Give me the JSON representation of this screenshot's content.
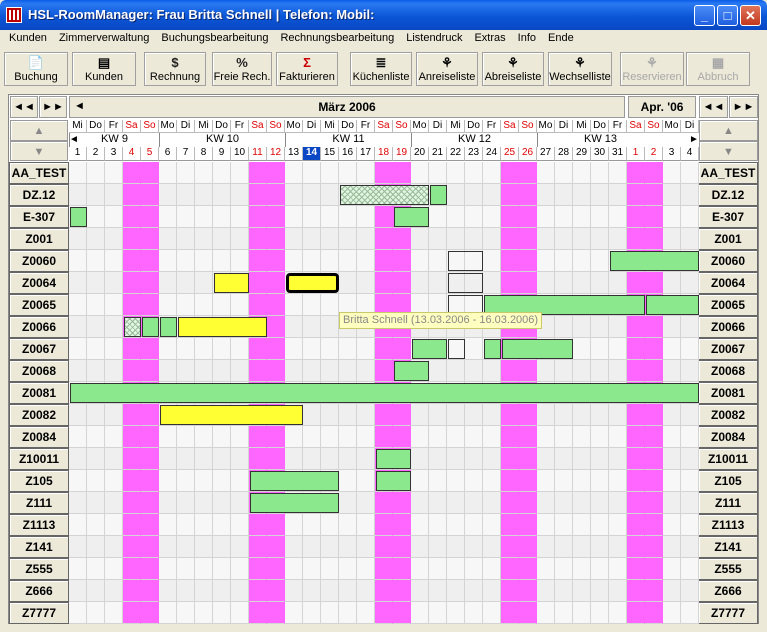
{
  "window": {
    "title": "HSL-RoomManager:  Frau Britta Schnell |  Telefon:  Mobil:",
    "minimize": "_",
    "maximize": "□",
    "close": "✕"
  },
  "menu": [
    "Kunden",
    "Zimmerverwaltung",
    "Buchungsbearbeitung",
    "Rechnungsbearbeitung",
    "Listendruck",
    "Extras",
    "Info",
    "Ende"
  ],
  "toolbar": [
    {
      "id": "buchung",
      "label": "Buchung",
      "icon": "📄",
      "icon_name": "document-icon",
      "enabled": true
    },
    {
      "id": "kunden",
      "label": "Kunden",
      "icon": "▤",
      "icon_name": "customers-icon",
      "enabled": true
    },
    {
      "id": "rechnung",
      "label": "Rechnung",
      "icon": "$",
      "icon_name": "dollar-icon",
      "enabled": true
    },
    {
      "id": "freie-rech",
      "label": "Freie Rech.",
      "icon": "%",
      "icon_name": "percent-icon",
      "enabled": true
    },
    {
      "id": "fakturieren",
      "label": "Fakturieren",
      "icon": "Σ",
      "icon_name": "sigma-icon",
      "enabled": true
    },
    {
      "id": "kuechenliste",
      "label": "Küchenliste",
      "icon": "≣",
      "icon_name": "list-icon",
      "enabled": true
    },
    {
      "id": "anreiseliste",
      "label": "Anreiseliste",
      "icon": "⚘",
      "icon_name": "arrival-icon",
      "enabled": true
    },
    {
      "id": "abreiseliste",
      "label": "Abreiseliste",
      "icon": "⚘",
      "icon_name": "departure-icon",
      "enabled": true
    },
    {
      "id": "wechselliste",
      "label": "Wechselliste",
      "icon": "⚘",
      "icon_name": "change-icon",
      "enabled": true
    },
    {
      "id": "reservieren",
      "label": "Reservieren",
      "icon": "⚘",
      "icon_name": "reserve-icon",
      "enabled": false
    },
    {
      "id": "abbruch",
      "label": "Abbruch",
      "icon": "▦",
      "icon_name": "cancel-icon",
      "enabled": false
    }
  ],
  "nav": {
    "prev_fast": "◄◄",
    "next_fast": "►►",
    "prev": "◄",
    "next": "►",
    "up": "▲",
    "down": "▼",
    "month_title": "März 2006",
    "next_month": "Apr. '06"
  },
  "calendar": {
    "weekdays": [
      "Mi",
      "Do",
      "Fr",
      "Sa",
      "So",
      "Mo",
      "Di",
      "Mi",
      "Do",
      "Fr",
      "Sa",
      "So",
      "Mo",
      "Di",
      "Mi",
      "Do",
      "Fr",
      "Sa",
      "So",
      "Mo",
      "Di",
      "Mi",
      "Do",
      "Fr",
      "Sa",
      "So",
      "Mo",
      "Di",
      "Mi",
      "Do",
      "Fr",
      "Sa",
      "So",
      "Mo",
      "Di"
    ],
    "days": [
      "1",
      "2",
      "3",
      "4",
      "5",
      "6",
      "7",
      "8",
      "9",
      "10",
      "11",
      "12",
      "13",
      "14",
      "15",
      "16",
      "17",
      "18",
      "19",
      "20",
      "21",
      "22",
      "23",
      "24",
      "25",
      "26",
      "27",
      "28",
      "29",
      "30",
      "31",
      "1",
      "2",
      "3",
      "4"
    ],
    "today_index": 13,
    "weekend_indices": [
      3,
      4,
      10,
      11,
      17,
      18,
      24,
      25,
      31,
      32
    ],
    "weeks": [
      {
        "label": "KW 9",
        "start": 0,
        "span": 5
      },
      {
        "label": "KW 10",
        "start": 5,
        "span": 7
      },
      {
        "label": "KW 11",
        "start": 12,
        "span": 7
      },
      {
        "label": "KW 12",
        "start": 19,
        "span": 7
      },
      {
        "label": "KW 13",
        "start": 26,
        "span": 7
      }
    ],
    "weekend_color": "#ff66ff",
    "today_color": "#0a47c4"
  },
  "rooms": [
    "AA_TEST",
    "DZ.12",
    "E-307",
    "Z001",
    "Z0060",
    "Z0064",
    "Z0065",
    "Z0066",
    "Z0067",
    "Z0068",
    "Z0081",
    "Z0082",
    "Z0084",
    "Z10011",
    "Z105",
    "Z111",
    "Z1113",
    "Z141",
    "Z555",
    "Z666",
    "Z7777"
  ],
  "bookings": [
    {
      "row": 1,
      "start": 15,
      "end": 19,
      "type": "hatch-green"
    },
    {
      "row": 1,
      "start": 20,
      "end": 20,
      "type": "green"
    },
    {
      "row": 2,
      "start": 0,
      "end": 0,
      "type": "green"
    },
    {
      "row": 2,
      "start": 18,
      "end": 19,
      "type": "green"
    },
    {
      "row": 4,
      "start": 21,
      "end": 22,
      "type": "hatch"
    },
    {
      "row": 4,
      "start": 30,
      "end": 34,
      "type": "green"
    },
    {
      "row": 5,
      "start": 8,
      "end": 9,
      "type": "yellow"
    },
    {
      "row": 5,
      "start": 12,
      "end": 14,
      "type": "yellow",
      "selected": true
    },
    {
      "row": 5,
      "start": 21,
      "end": 22,
      "type": "hatch"
    },
    {
      "row": 6,
      "start": 21,
      "end": 22,
      "type": "hatch"
    },
    {
      "row": 6,
      "start": 23,
      "end": 31,
      "type": "green"
    },
    {
      "row": 6,
      "start": 32,
      "end": 34,
      "type": "green"
    },
    {
      "row": 7,
      "start": 3,
      "end": 3,
      "type": "hatch-green"
    },
    {
      "row": 7,
      "start": 4,
      "end": 4,
      "type": "green"
    },
    {
      "row": 7,
      "start": 5,
      "end": 5,
      "type": "green"
    },
    {
      "row": 7,
      "start": 6,
      "end": 10,
      "type": "yellow"
    },
    {
      "row": 8,
      "start": 19,
      "end": 20,
      "type": "green"
    },
    {
      "row": 8,
      "start": 21,
      "end": 21,
      "type": "hatch"
    },
    {
      "row": 8,
      "start": 23,
      "end": 23,
      "type": "green"
    },
    {
      "row": 8,
      "start": 24,
      "end": 27,
      "type": "green"
    },
    {
      "row": 9,
      "start": 18,
      "end": 19,
      "type": "green"
    },
    {
      "row": 10,
      "start": 0,
      "end": 34,
      "type": "green"
    },
    {
      "row": 11,
      "start": 5,
      "end": 12,
      "type": "yellow"
    },
    {
      "row": 13,
      "start": 17,
      "end": 18,
      "type": "green"
    },
    {
      "row": 14,
      "start": 10,
      "end": 14,
      "type": "green"
    },
    {
      "row": 14,
      "start": 17,
      "end": 18,
      "type": "green"
    },
    {
      "row": 15,
      "start": 10,
      "end": 14,
      "type": "green"
    }
  ],
  "tooltip": "Britta Schnell (13.03.2006 - 16.03.2006)"
}
